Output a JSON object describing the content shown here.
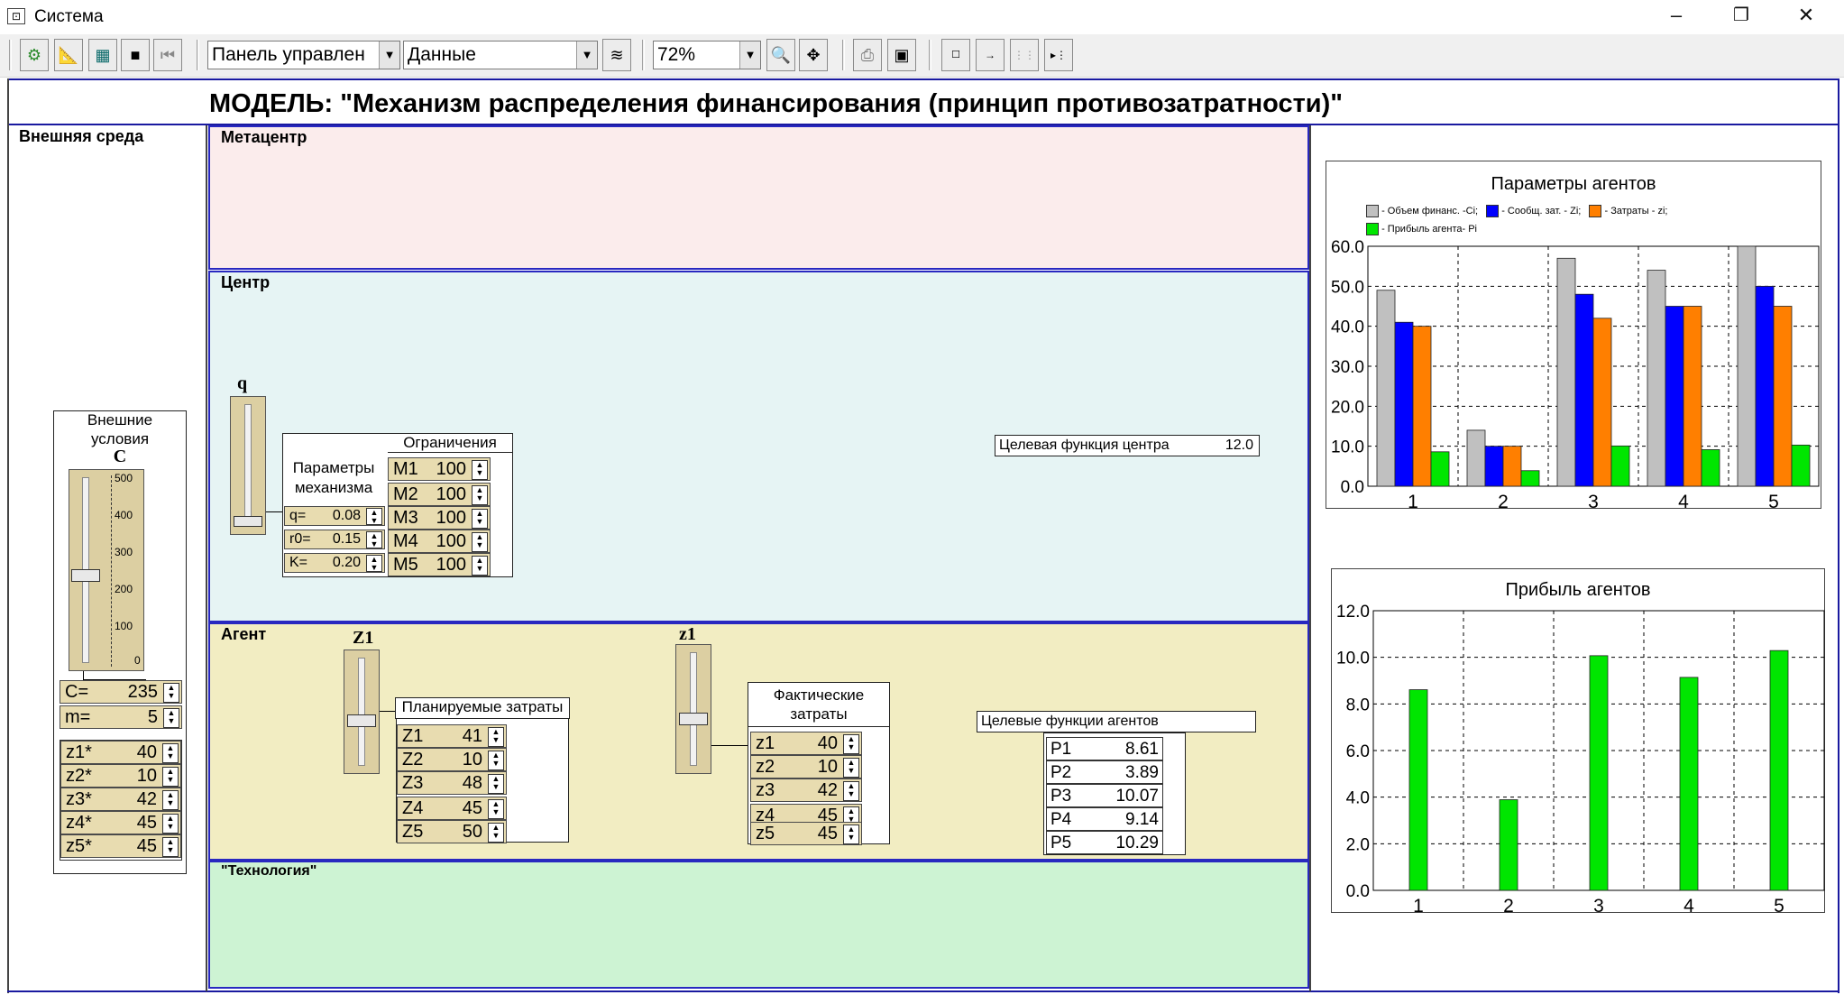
{
  "window": {
    "title": "Система",
    "minimize": "–",
    "restore": "❐",
    "close": "✕"
  },
  "toolbar": {
    "panel_combo": "Панель управлен",
    "data_combo": "Данные",
    "zoom_combo": "72%"
  },
  "model_title": "МОДЕЛЬ: \"Механизм распределения финансирования (принцип противозатратности)\"",
  "left": {
    "label": "Внешняя среда",
    "ext_title_line1": "Внешние",
    "ext_title_line2": "условия",
    "slider_label": "C",
    "scale": [
      "500",
      "400",
      "300",
      "200",
      "100",
      "0"
    ],
    "c_label": "C=",
    "c_value": "235",
    "m_label": "m=",
    "m_value": "5",
    "z_star": [
      {
        "label": "z1*",
        "value": "40"
      },
      {
        "label": "z2*",
        "value": "10"
      },
      {
        "label": "z3*",
        "value": "42"
      },
      {
        "label": "z4*",
        "value": "45"
      },
      {
        "label": "z5*",
        "value": "45"
      }
    ],
    "slider_c_level": 0.47
  },
  "metacenter": {
    "label": "Метацентр"
  },
  "center": {
    "label": "Центр",
    "q_label": "q",
    "q_level": 0.0,
    "restrictions_title": "Ограничения",
    "params_title_line1": "Параметры",
    "params_title_line2": "механизма",
    "params": [
      {
        "label": "q=",
        "value": "0.08"
      },
      {
        "label": "r0=",
        "value": "0.15"
      },
      {
        "label": "K=",
        "value": "0.20"
      }
    ],
    "m_values": [
      {
        "label": "M1",
        "value": "100"
      },
      {
        "label": "M2",
        "value": "100"
      },
      {
        "label": "M3",
        "value": "100"
      },
      {
        "label": "M4",
        "value": "100"
      },
      {
        "label": "M5",
        "value": "100"
      }
    ],
    "target_label": "Целевая функция центра",
    "target_value": "12.0"
  },
  "agent": {
    "label": "Агент",
    "Z1_label": "Z1",
    "z1_label": "z1",
    "Z1_level": 0.41,
    "z1_level": 0.4,
    "planned_title": "Планируемые затраты",
    "planned": [
      {
        "label": "Z1",
        "value": "41"
      },
      {
        "label": "Z2",
        "value": "10"
      },
      {
        "label": "Z3",
        "value": "48"
      },
      {
        "label": "Z4",
        "value": "45"
      },
      {
        "label": "Z5",
        "value": "50"
      }
    ],
    "actual_title_line1": "Фактические",
    "actual_title_line2": "затраты",
    "actual": [
      {
        "label": "z1",
        "value": "40"
      },
      {
        "label": "z2",
        "value": "10"
      },
      {
        "label": "z3",
        "value": "42"
      },
      {
        "label": "z4",
        "value": "45"
      },
      {
        "label": "z5",
        "value": "45"
      }
    ],
    "targets_title": "Целевые функции агентов",
    "targets": [
      {
        "label": "P1",
        "value": "8.61"
      },
      {
        "label": "P2",
        "value": "3.89"
      },
      {
        "label": "P3",
        "value": "10.07"
      },
      {
        "label": "P4",
        "value": "9.14"
      },
      {
        "label": "P5",
        "value": "10.29"
      }
    ]
  },
  "technology": {
    "label": "\"Технология\""
  },
  "chart_data": [
    {
      "type": "bar",
      "title": "Параметры агентов",
      "categories": [
        "1",
        "2",
        "3",
        "4",
        "5"
      ],
      "ylim": [
        0,
        60
      ],
      "yticks": [
        "0.0",
        "10.0",
        "20.0",
        "30.0",
        "40.0",
        "50.0",
        "60.0"
      ],
      "grid": true,
      "legend_placement": "top",
      "series": [
        {
          "name": "- Объем финанс. -Ci;",
          "color": "#c0c0c0",
          "values": [
            49,
            14,
            57,
            54,
            60
          ]
        },
        {
          "name": "- Сообщ. зат. - Zi;",
          "color": "#0000ff",
          "values": [
            41,
            10,
            48,
            45,
            50
          ]
        },
        {
          "name": "- Затраты - zi;",
          "color": "#ff7f00",
          "values": [
            40,
            10,
            42,
            45,
            45
          ]
        },
        {
          "name": "- Прибыль агента- Pi",
          "color": "#00e600",
          "values": [
            8.61,
            3.89,
            10.07,
            9.14,
            10.29
          ]
        }
      ]
    },
    {
      "type": "bar",
      "title": "Прибыль агентов",
      "categories": [
        "1",
        "2",
        "3",
        "4",
        "5"
      ],
      "ylim": [
        0,
        12
      ],
      "yticks": [
        "0.0",
        "2.0",
        "4.0",
        "6.0",
        "8.0",
        "10.0",
        "12.0"
      ],
      "grid": true,
      "series": [
        {
          "color": "#00e600",
          "values": [
            8.61,
            3.89,
            10.07,
            9.14,
            10.29
          ]
        }
      ]
    }
  ]
}
